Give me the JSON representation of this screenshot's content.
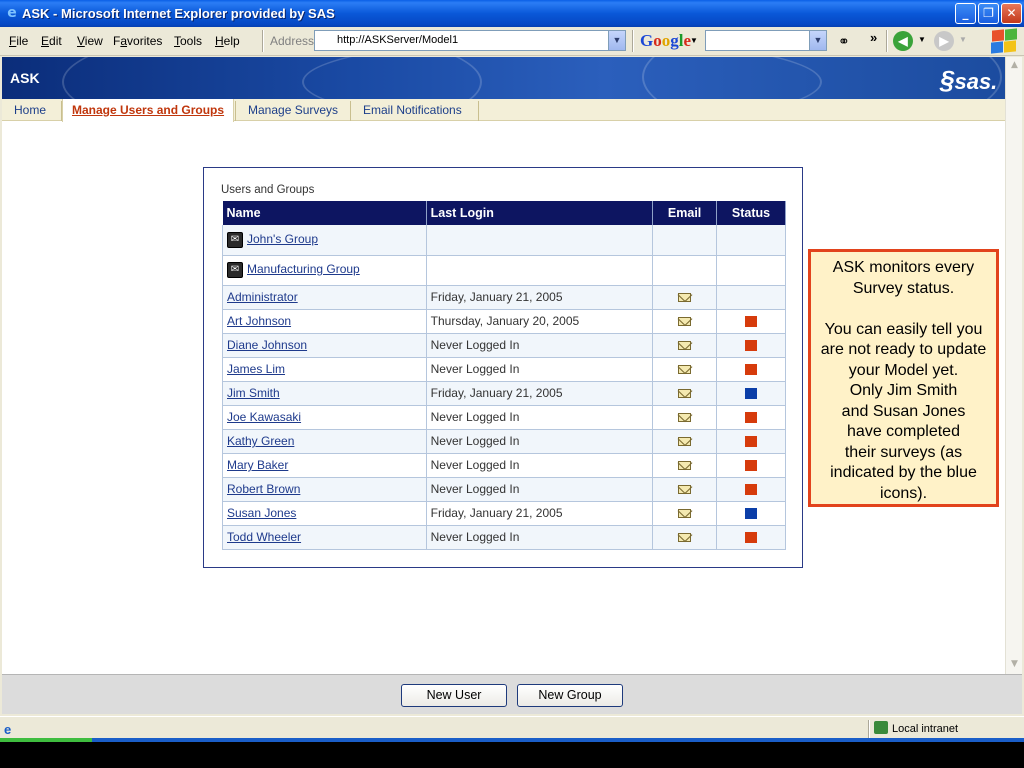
{
  "window": {
    "title": "ASK - Microsoft Internet Explorer provided by SAS"
  },
  "menu": {
    "items": [
      {
        "label": "File",
        "key": "F",
        "rest": "ile"
      },
      {
        "label": "Edit",
        "key": "E",
        "rest": "dit"
      },
      {
        "label": "View",
        "key": "V",
        "rest": "iew"
      },
      {
        "label": "Favorites",
        "key": "",
        "rest": ""
      },
      {
        "label": "Tools",
        "key": "T",
        "rest": "ools"
      },
      {
        "label": "Help",
        "key": "H",
        "rest": "elp"
      }
    ],
    "favorites_pre": "F",
    "favorites_key": "a",
    "favorites_post": "vorites"
  },
  "address": {
    "label": "Address",
    "url": "http://ASKServer/Model1"
  },
  "google": {
    "g1": "G",
    "o1": "o",
    "o2": "o",
    "g2": "g",
    "l": "l",
    "e": "e"
  },
  "app": {
    "name": "ASK",
    "brand": "sas."
  },
  "tabs": [
    {
      "label": "Home"
    },
    {
      "label": "Manage Users and Groups"
    },
    {
      "label": "Manage Surveys"
    },
    {
      "label": "Email Notifications"
    }
  ],
  "panel": {
    "title": "Users and Groups",
    "columns": [
      "Name",
      "Last Login",
      "Email",
      "Status"
    ],
    "groups": [
      {
        "name": "John's Group"
      },
      {
        "name": "Manufacturing Group"
      }
    ],
    "users": [
      {
        "name": "Administrator",
        "last_login": "Friday, January 21, 2005",
        "status": "none"
      },
      {
        "name": "Art Johnson",
        "last_login": "Thursday, January 20, 2005",
        "status": "red"
      },
      {
        "name": "Diane Johnson",
        "last_login": "Never Logged In",
        "status": "red"
      },
      {
        "name": "James Lim",
        "last_login": "Never Logged In",
        "status": "red"
      },
      {
        "name": "Jim Smith",
        "last_login": "Friday, January 21, 2005",
        "status": "blue"
      },
      {
        "name": "Joe Kawasaki",
        "last_login": "Never Logged In",
        "status": "red"
      },
      {
        "name": "Kathy Green",
        "last_login": "Never Logged In",
        "status": "red"
      },
      {
        "name": "Mary Baker",
        "last_login": "Never Logged In",
        "status": "red"
      },
      {
        "name": "Robert Brown",
        "last_login": "Never Logged In",
        "status": "red"
      },
      {
        "name": "Susan Jones",
        "last_login": "Friday, January 21, 2005",
        "status": "blue"
      },
      {
        "name": "Todd Wheeler",
        "last_login": "Never Logged In",
        "status": "red"
      }
    ]
  },
  "callout": {
    "lines": [
      "ASK monitors every",
      "Survey status.",
      "",
      "You can easily tell you",
      "are not ready to update",
      "your Model yet.",
      "Only Jim Smith",
      "and Susan Jones",
      "have completed",
      "their surveys (as",
      "indicated by the blue",
      "icons)."
    ]
  },
  "buttons": {
    "new_user": "New User",
    "new_group": "New Group"
  },
  "statusbar": {
    "zone": "Local intranet"
  },
  "colors": {
    "status_red": "#d63b0c",
    "status_blue": "#0b3ea8",
    "header_navy": "#0d1561",
    "callout_border": "#e2431c",
    "callout_bg": "#fff2c8"
  }
}
